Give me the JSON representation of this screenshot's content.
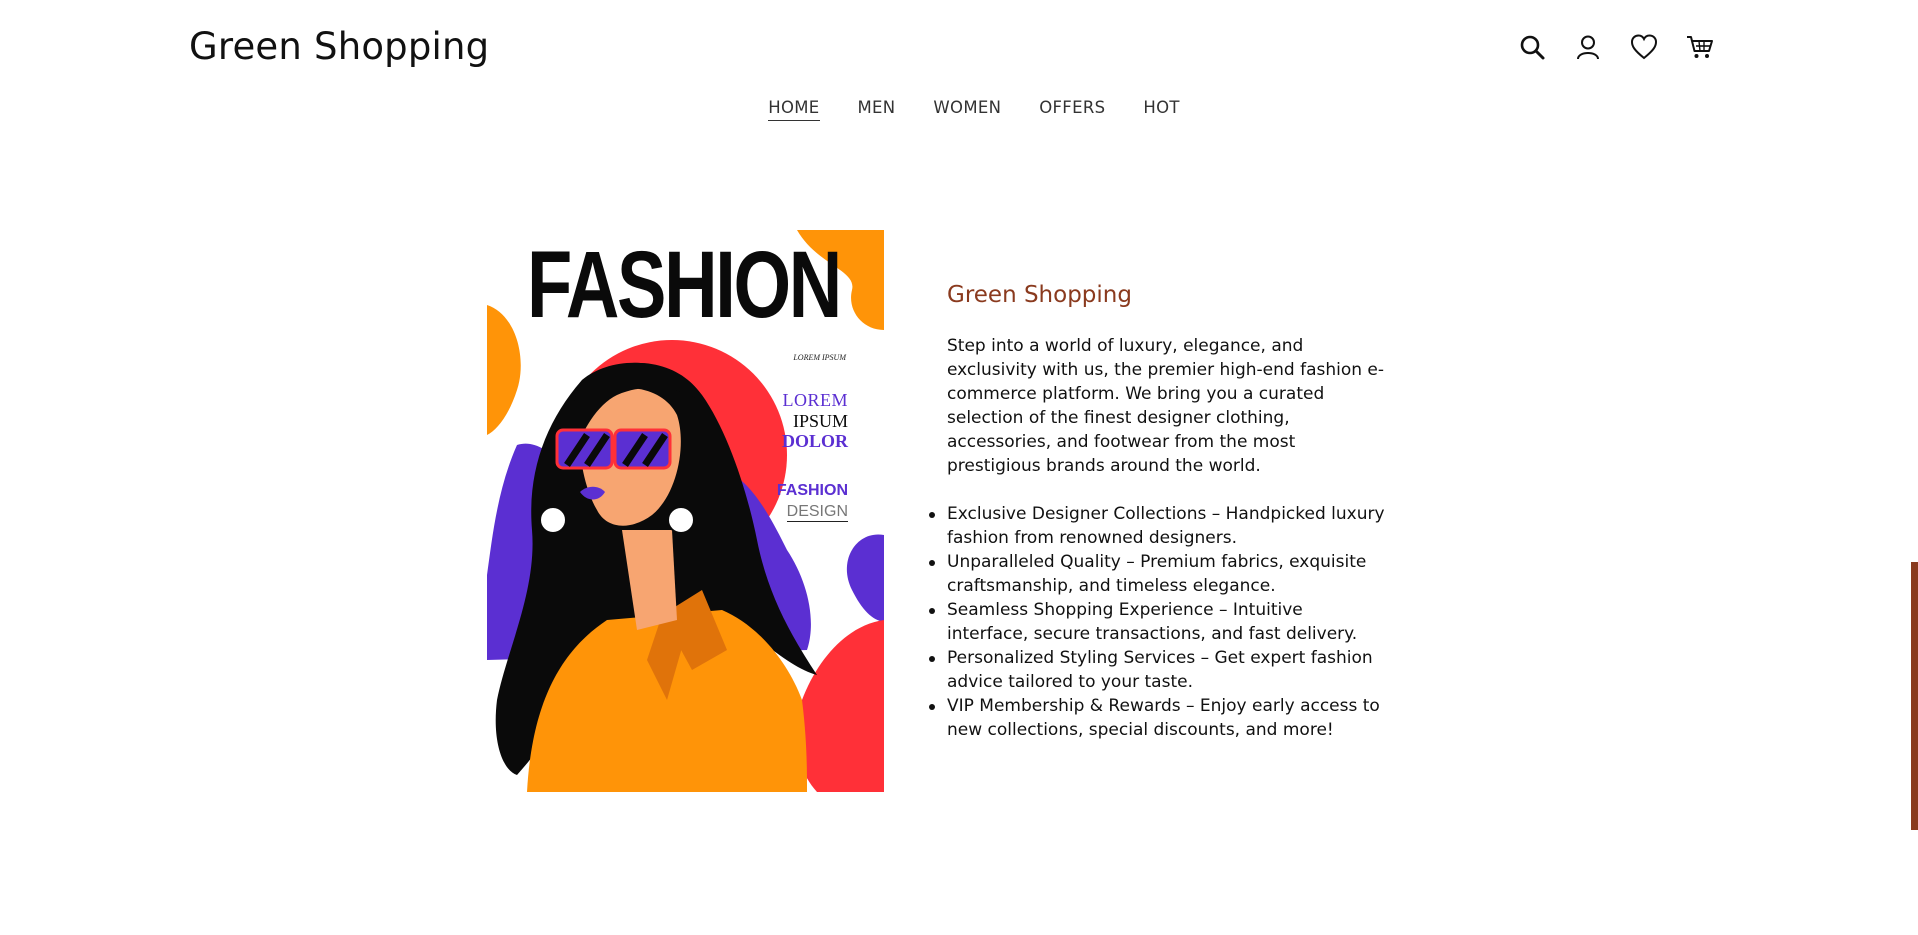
{
  "brand": {
    "name": "Green Shopping"
  },
  "header_icons": [
    "search-icon",
    "account-icon",
    "wishlist-heart-icon",
    "cart-icon"
  ],
  "nav": {
    "items": [
      {
        "label": "HOME",
        "active": true
      },
      {
        "label": "MEN",
        "active": false
      },
      {
        "label": "WOMEN",
        "active": false
      },
      {
        "label": "OFFERS",
        "active": false
      },
      {
        "label": "HOT",
        "active": false
      }
    ]
  },
  "poster": {
    "headline": "FASHION",
    "tagline": "LOREM IPSUM",
    "lorem1": "LOREM",
    "lorem2": "IPSUM",
    "lorem3": "DOLOR",
    "fashion": "FASHION",
    "design": "DESIGN"
  },
  "about": {
    "title": "Green Shopping",
    "intro": "Step into a world of luxury, elegance, and exclusivity with us, the premier high-end fashion e-commerce platform. We bring you a curated selection of the finest designer clothing, accessories, and footwear from the most prestigious brands around the world.",
    "features": [
      "Exclusive Designer Collections – Handpicked luxury fashion from renowned designers.",
      "Unparalleled Quality – Premium fabrics, exquisite craftsmanship, and timeless elegance.",
      "Seamless Shopping Experience – Intuitive interface, secure transactions, and fast delivery.",
      "Personalized Styling Services – Get expert fashion advice tailored to your taste.",
      "VIP Membership & Rewards – Enjoy early access to new collections, special discounts, and more!"
    ]
  },
  "colors": {
    "accent": "#8a3a1e",
    "poster_orange": "#ff9408",
    "poster_red": "#ff3038",
    "poster_purple": "#5b2fd2"
  }
}
